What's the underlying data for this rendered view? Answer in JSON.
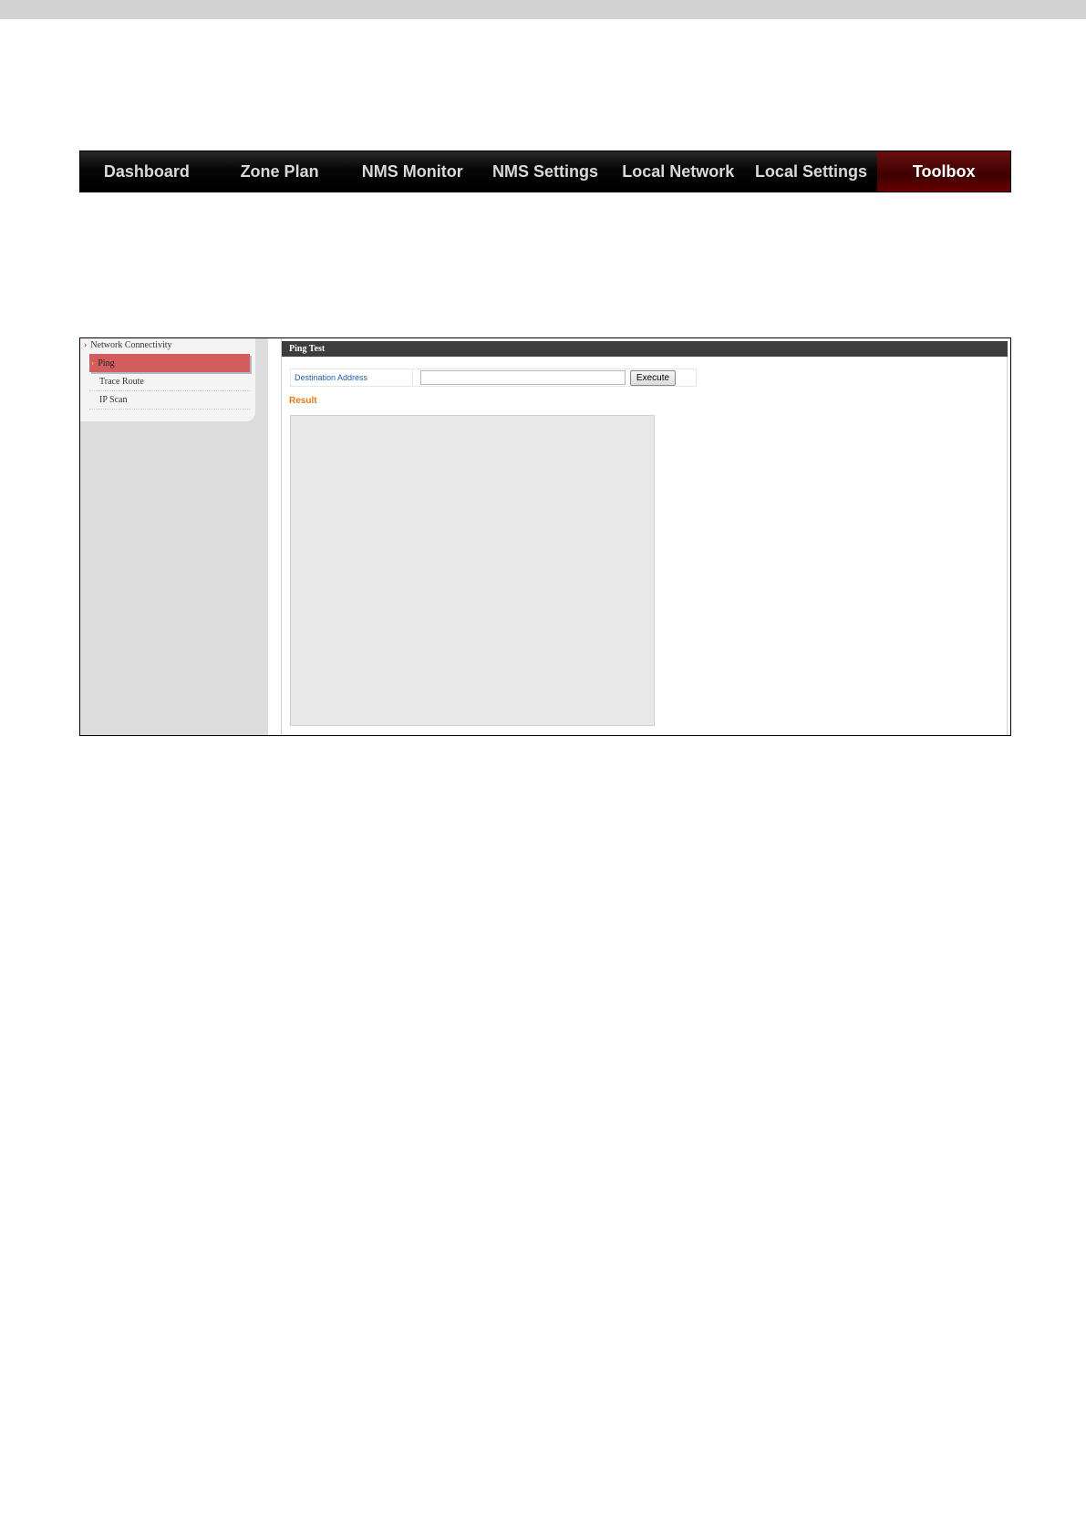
{
  "nav": {
    "items": [
      {
        "label": "Dashboard"
      },
      {
        "label": "Zone Plan"
      },
      {
        "label": "NMS Monitor"
      },
      {
        "label": "NMS Settings"
      },
      {
        "label": "Local Network"
      },
      {
        "label": "Local Settings"
      },
      {
        "label": "Toolbox",
        "active": true
      }
    ]
  },
  "sidebar": {
    "group_label": "Network Connectivity",
    "items": [
      {
        "label": "Ping",
        "active": true
      },
      {
        "label": "Trace Route"
      },
      {
        "label": "IP Scan"
      }
    ]
  },
  "panel": {
    "title": "Ping Test",
    "destination_label": "Destination Address",
    "destination_value": "",
    "execute_label": "Execute",
    "result_label": "Result",
    "result_text": ""
  },
  "colors": {
    "nav_active": "#4a0000",
    "sidebar_active": "#d35c5c",
    "label_blue": "#1f5aa6",
    "result_orange": "#e07a1a"
  }
}
